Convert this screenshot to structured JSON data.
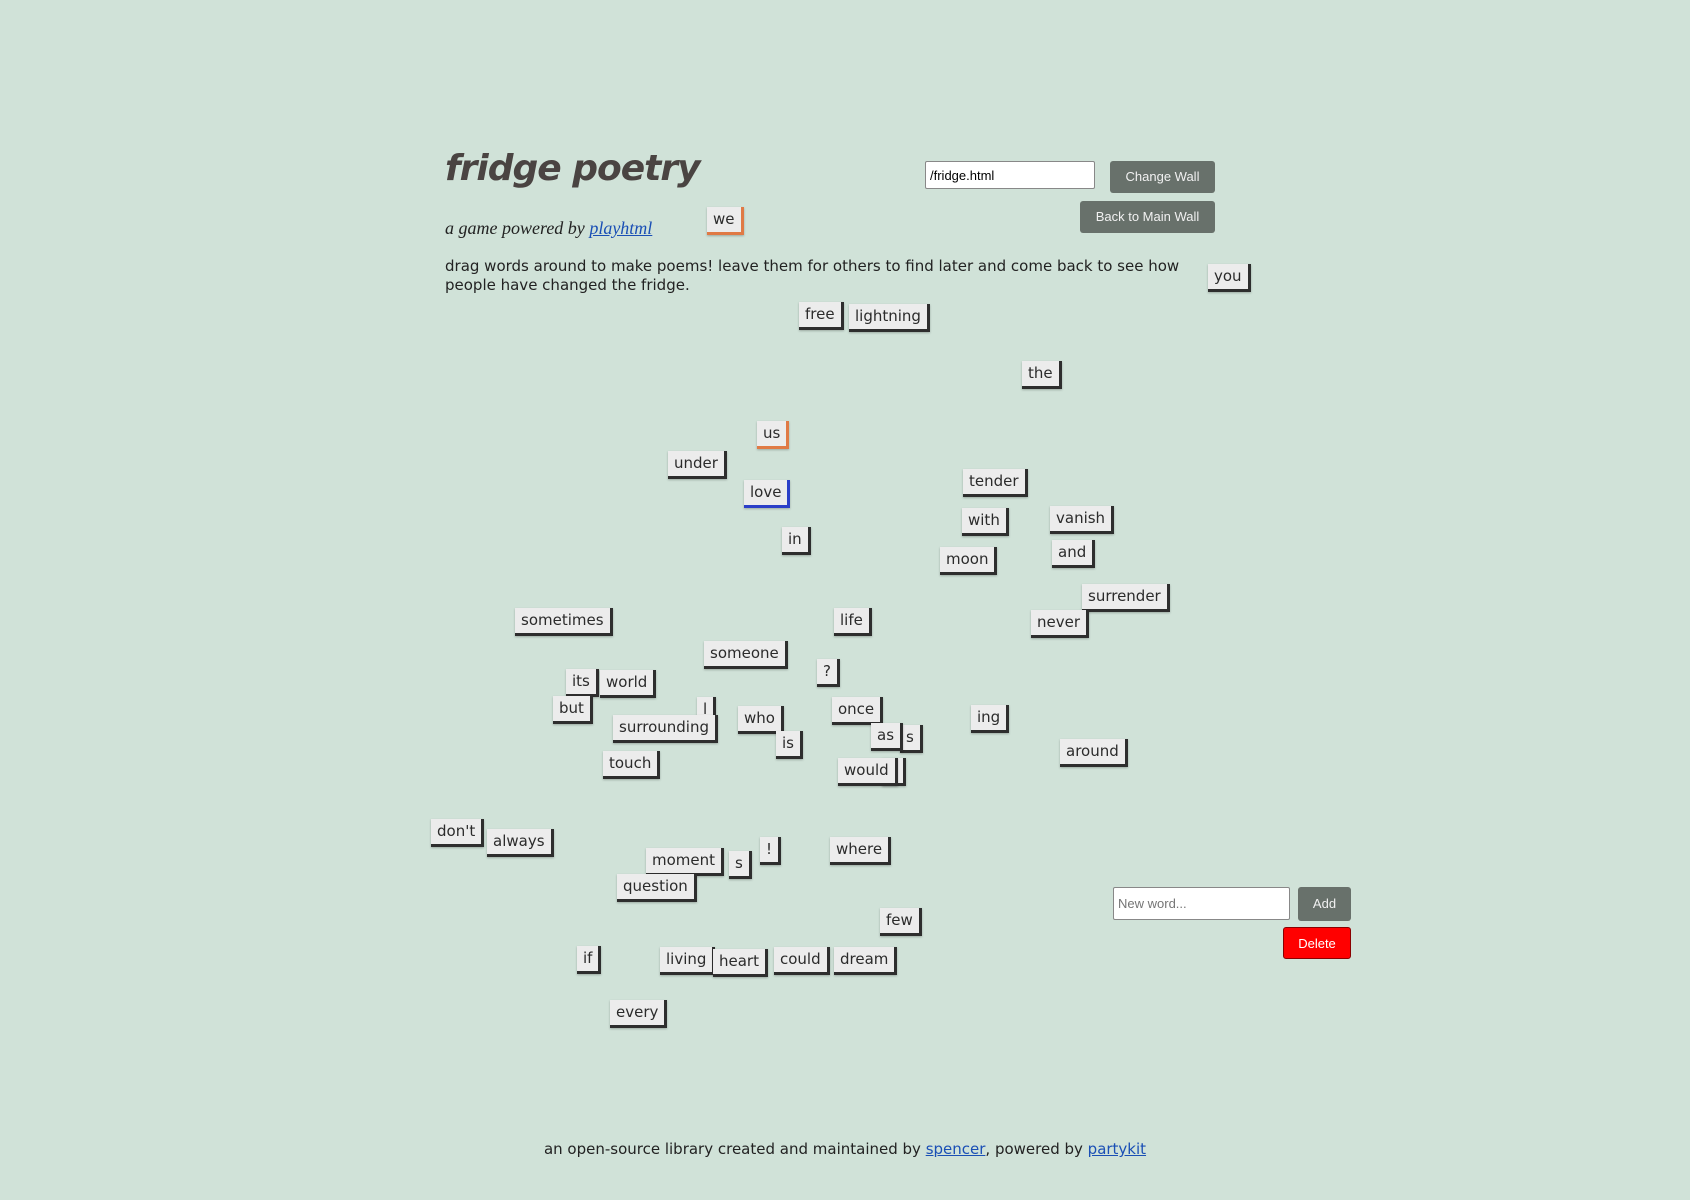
{
  "header": {
    "title": "fridge poetry",
    "subtitle_prefix": "a game powered by ",
    "subtitle_link": "playhtml",
    "instructions": "drag words around to make poems! leave them for others to find later and come back to see how people have changed the fridge."
  },
  "wall_controls": {
    "wall_input_value": "/fridge.html",
    "change_wall_label": "Change Wall",
    "back_main_label": "Back to Main Wall"
  },
  "word_controls": {
    "new_word_placeholder": "New word...",
    "add_label": "Add",
    "delete_label": "Delete"
  },
  "colors": {
    "background": "#d0e2d8",
    "magnet_border": "#2e2e2e",
    "accent_orange": "#e07a45",
    "accent_blue": "#2b3fc8",
    "delete_red": "#ff0000"
  },
  "words": [
    {
      "text": "we",
      "accent": "#e07a45"
    },
    {
      "text": "you"
    },
    {
      "text": "free"
    },
    {
      "text": "lightning"
    },
    {
      "text": "the"
    },
    {
      "text": "us",
      "accent": "#e07a45"
    },
    {
      "text": "under"
    },
    {
      "text": "love",
      "accent": "#2b3fc8"
    },
    {
      "text": "tender"
    },
    {
      "text": "with"
    },
    {
      "text": "vanish"
    },
    {
      "text": "in"
    },
    {
      "text": "and"
    },
    {
      "text": "moon"
    },
    {
      "text": "surrender"
    },
    {
      "text": "sometimes"
    },
    {
      "text": "life"
    },
    {
      "text": "never"
    },
    {
      "text": "someone"
    },
    {
      "text": "its"
    },
    {
      "text": "world"
    },
    {
      "text": "?"
    },
    {
      "text": "l"
    },
    {
      "text": "but"
    },
    {
      "text": "who"
    },
    {
      "text": "once"
    },
    {
      "text": "ing"
    },
    {
      "text": "surrounding"
    },
    {
      "text": "is"
    },
    {
      "text": "s"
    },
    {
      "text": "as"
    },
    {
      "text": "around"
    },
    {
      "text": "e"
    },
    {
      "text": "touch"
    },
    {
      "text": "would"
    },
    {
      "text": "don't"
    },
    {
      "text": "always"
    },
    {
      "text": "!"
    },
    {
      "text": "where"
    },
    {
      "text": "moment"
    },
    {
      "text": "s"
    },
    {
      "text": "question"
    },
    {
      "text": "few"
    },
    {
      "text": "if"
    },
    {
      "text": "living"
    },
    {
      "text": "heart"
    },
    {
      "text": "could"
    },
    {
      "text": "dream"
    },
    {
      "text": "every"
    }
  ],
  "footer": {
    "prefix": "an open-source library created and maintained by ",
    "link1": "spencer",
    "middle": ", powered by ",
    "link2": "partykit"
  }
}
